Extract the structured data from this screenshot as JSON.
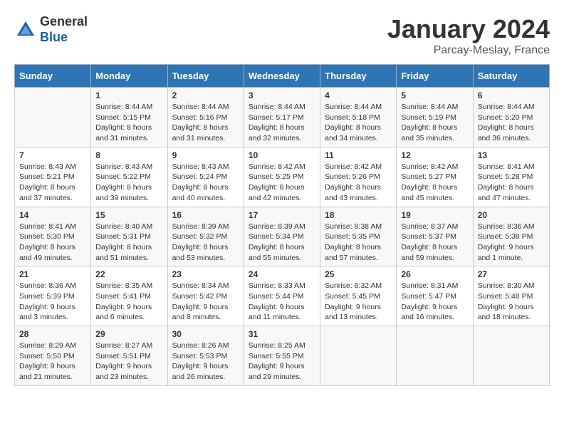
{
  "header": {
    "logo_line1": "General",
    "logo_line2": "Blue",
    "month": "January 2024",
    "location": "Parcay-Meslay, France"
  },
  "weekdays": [
    "Sunday",
    "Monday",
    "Tuesday",
    "Wednesday",
    "Thursday",
    "Friday",
    "Saturday"
  ],
  "weeks": [
    [
      {
        "day": "",
        "sunrise": "",
        "sunset": "",
        "daylight": ""
      },
      {
        "day": "1",
        "sunrise": "Sunrise: 8:44 AM",
        "sunset": "Sunset: 5:15 PM",
        "daylight": "Daylight: 8 hours and 31 minutes."
      },
      {
        "day": "2",
        "sunrise": "Sunrise: 8:44 AM",
        "sunset": "Sunset: 5:16 PM",
        "daylight": "Daylight: 8 hours and 31 minutes."
      },
      {
        "day": "3",
        "sunrise": "Sunrise: 8:44 AM",
        "sunset": "Sunset: 5:17 PM",
        "daylight": "Daylight: 8 hours and 32 minutes."
      },
      {
        "day": "4",
        "sunrise": "Sunrise: 8:44 AM",
        "sunset": "Sunset: 5:18 PM",
        "daylight": "Daylight: 8 hours and 34 minutes."
      },
      {
        "day": "5",
        "sunrise": "Sunrise: 8:44 AM",
        "sunset": "Sunset: 5:19 PM",
        "daylight": "Daylight: 8 hours and 35 minutes."
      },
      {
        "day": "6",
        "sunrise": "Sunrise: 8:44 AM",
        "sunset": "Sunset: 5:20 PM",
        "daylight": "Daylight: 8 hours and 36 minutes."
      }
    ],
    [
      {
        "day": "7",
        "sunrise": "Sunrise: 8:43 AM",
        "sunset": "Sunset: 5:21 PM",
        "daylight": "Daylight: 8 hours and 37 minutes."
      },
      {
        "day": "8",
        "sunrise": "Sunrise: 8:43 AM",
        "sunset": "Sunset: 5:22 PM",
        "daylight": "Daylight: 8 hours and 39 minutes."
      },
      {
        "day": "9",
        "sunrise": "Sunrise: 8:43 AM",
        "sunset": "Sunset: 5:24 PM",
        "daylight": "Daylight: 8 hours and 40 minutes."
      },
      {
        "day": "10",
        "sunrise": "Sunrise: 8:42 AM",
        "sunset": "Sunset: 5:25 PM",
        "daylight": "Daylight: 8 hours and 42 minutes."
      },
      {
        "day": "11",
        "sunrise": "Sunrise: 8:42 AM",
        "sunset": "Sunset: 5:26 PM",
        "daylight": "Daylight: 8 hours and 43 minutes."
      },
      {
        "day": "12",
        "sunrise": "Sunrise: 8:42 AM",
        "sunset": "Sunset: 5:27 PM",
        "daylight": "Daylight: 8 hours and 45 minutes."
      },
      {
        "day": "13",
        "sunrise": "Sunrise: 8:41 AM",
        "sunset": "Sunset: 5:28 PM",
        "daylight": "Daylight: 8 hours and 47 minutes."
      }
    ],
    [
      {
        "day": "14",
        "sunrise": "Sunrise: 8:41 AM",
        "sunset": "Sunset: 5:30 PM",
        "daylight": "Daylight: 8 hours and 49 minutes."
      },
      {
        "day": "15",
        "sunrise": "Sunrise: 8:40 AM",
        "sunset": "Sunset: 5:31 PM",
        "daylight": "Daylight: 8 hours and 51 minutes."
      },
      {
        "day": "16",
        "sunrise": "Sunrise: 8:39 AM",
        "sunset": "Sunset: 5:32 PM",
        "daylight": "Daylight: 8 hours and 53 minutes."
      },
      {
        "day": "17",
        "sunrise": "Sunrise: 8:39 AM",
        "sunset": "Sunset: 5:34 PM",
        "daylight": "Daylight: 8 hours and 55 minutes."
      },
      {
        "day": "18",
        "sunrise": "Sunrise: 8:38 AM",
        "sunset": "Sunset: 5:35 PM",
        "daylight": "Daylight: 8 hours and 57 minutes."
      },
      {
        "day": "19",
        "sunrise": "Sunrise: 8:37 AM",
        "sunset": "Sunset: 5:37 PM",
        "daylight": "Daylight: 8 hours and 59 minutes."
      },
      {
        "day": "20",
        "sunrise": "Sunrise: 8:36 AM",
        "sunset": "Sunset: 5:38 PM",
        "daylight": "Daylight: 9 hours and 1 minute."
      }
    ],
    [
      {
        "day": "21",
        "sunrise": "Sunrise: 8:36 AM",
        "sunset": "Sunset: 5:39 PM",
        "daylight": "Daylight: 9 hours and 3 minutes."
      },
      {
        "day": "22",
        "sunrise": "Sunrise: 8:35 AM",
        "sunset": "Sunset: 5:41 PM",
        "daylight": "Daylight: 9 hours and 6 minutes."
      },
      {
        "day": "23",
        "sunrise": "Sunrise: 8:34 AM",
        "sunset": "Sunset: 5:42 PM",
        "daylight": "Daylight: 9 hours and 8 minutes."
      },
      {
        "day": "24",
        "sunrise": "Sunrise: 8:33 AM",
        "sunset": "Sunset: 5:44 PM",
        "daylight": "Daylight: 9 hours and 11 minutes."
      },
      {
        "day": "25",
        "sunrise": "Sunrise: 8:32 AM",
        "sunset": "Sunset: 5:45 PM",
        "daylight": "Daylight: 9 hours and 13 minutes."
      },
      {
        "day": "26",
        "sunrise": "Sunrise: 8:31 AM",
        "sunset": "Sunset: 5:47 PM",
        "daylight": "Daylight: 9 hours and 16 minutes."
      },
      {
        "day": "27",
        "sunrise": "Sunrise: 8:30 AM",
        "sunset": "Sunset: 5:48 PM",
        "daylight": "Daylight: 9 hours and 18 minutes."
      }
    ],
    [
      {
        "day": "28",
        "sunrise": "Sunrise: 8:29 AM",
        "sunset": "Sunset: 5:50 PM",
        "daylight": "Daylight: 9 hours and 21 minutes."
      },
      {
        "day": "29",
        "sunrise": "Sunrise: 8:27 AM",
        "sunset": "Sunset: 5:51 PM",
        "daylight": "Daylight: 9 hours and 23 minutes."
      },
      {
        "day": "30",
        "sunrise": "Sunrise: 8:26 AM",
        "sunset": "Sunset: 5:53 PM",
        "daylight": "Daylight: 9 hours and 26 minutes."
      },
      {
        "day": "31",
        "sunrise": "Sunrise: 8:25 AM",
        "sunset": "Sunset: 5:55 PM",
        "daylight": "Daylight: 9 hours and 29 minutes."
      },
      {
        "day": "",
        "sunrise": "",
        "sunset": "",
        "daylight": ""
      },
      {
        "day": "",
        "sunrise": "",
        "sunset": "",
        "daylight": ""
      },
      {
        "day": "",
        "sunrise": "",
        "sunset": "",
        "daylight": ""
      }
    ]
  ]
}
